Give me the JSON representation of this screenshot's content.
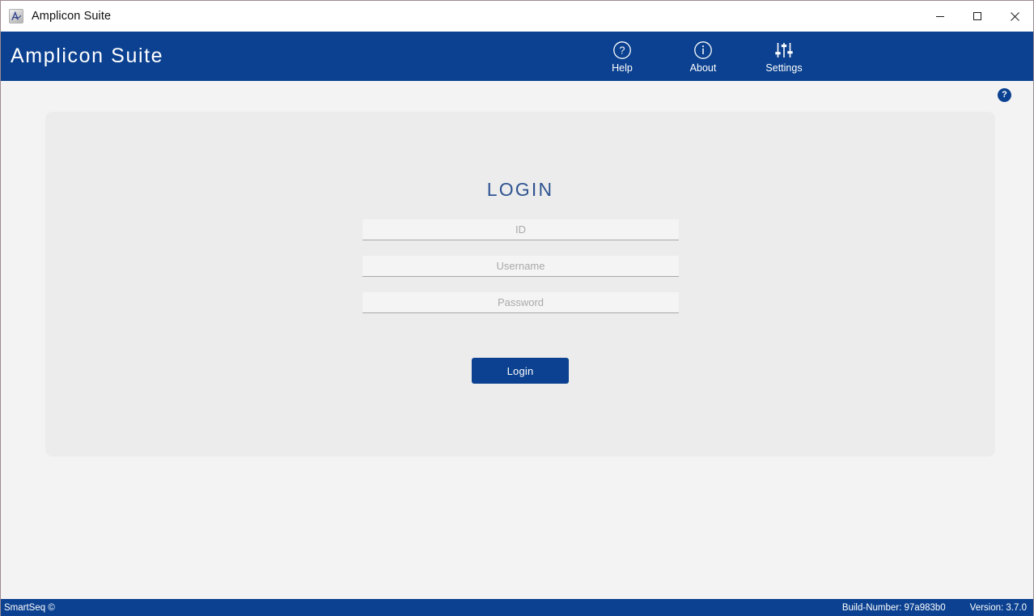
{
  "window": {
    "title": "Amplicon Suite",
    "icon": "app-logo-icon",
    "controls": {
      "minimize": "minimize-icon",
      "maximize": "maximize-icon",
      "close": "close-icon"
    }
  },
  "header": {
    "brand": "Amplicon Suite",
    "brand_color": "#0b4190",
    "actions": [
      {
        "label": "Help",
        "icon": "question-circle-icon"
      },
      {
        "label": "About",
        "icon": "info-circle-icon"
      },
      {
        "label": "Settings",
        "icon": "sliders-icon"
      }
    ]
  },
  "content": {
    "help_badge": {
      "label": "?",
      "icon": "help-badge-icon"
    },
    "login": {
      "title": "LOGIN",
      "title_color": "#2e5391",
      "fields": [
        {
          "name": "id",
          "placeholder": "ID",
          "value": ""
        },
        {
          "name": "username",
          "placeholder": "Username",
          "value": ""
        },
        {
          "name": "password",
          "placeholder": "Password",
          "value": ""
        }
      ],
      "submit_label": "Login",
      "submit_color": "#0b4190"
    }
  },
  "status_bar": {
    "left": "SmartSeq ©",
    "build": "Build-Number: 97a983b0",
    "version": "Version: 3.7.0"
  }
}
